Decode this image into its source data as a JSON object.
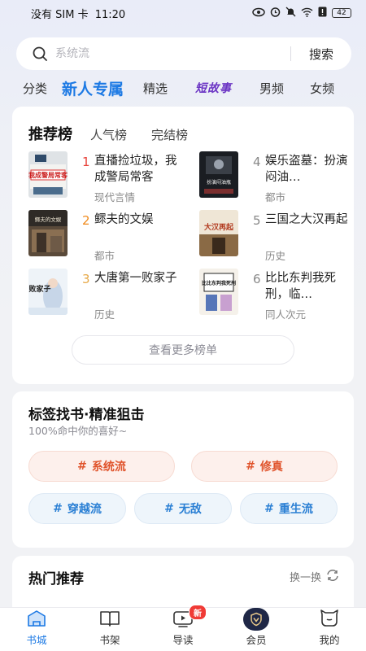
{
  "status_bar": {
    "carrier": "没有 SIM 卡",
    "time": "11:20",
    "battery": "42"
  },
  "search": {
    "placeholder": "系统流",
    "button": "搜索"
  },
  "channels": [
    "分类",
    "新人专属",
    "精选",
    "短故事",
    "男频",
    "女频"
  ],
  "active_channel": "新人专属",
  "ranking": {
    "tabs": [
      "推荐榜",
      "人气榜",
      "完结榜"
    ],
    "books": [
      {
        "rank": "1",
        "title": "直播捡垃圾，我成警局常客",
        "genre": "现代言情",
        "cover_text": "我成警局常客"
      },
      {
        "rank": "2",
        "title": "鳏夫的文娱",
        "genre": "都市",
        "cover_text": "鳏夫的文娱"
      },
      {
        "rank": "3",
        "title": "大唐第一败家子",
        "genre": "历史",
        "cover_text": "败家子"
      },
      {
        "rank": "4",
        "title": "娱乐盗墓：扮演闷油…",
        "genre": "都市",
        "cover_text": "扮演闷油瓶"
      },
      {
        "rank": "5",
        "title": "三国之大汉再起",
        "genre": "历史",
        "cover_text": "大汉再起"
      },
      {
        "rank": "6",
        "title": "比比东判我死刑，临…",
        "genre": "同人次元",
        "cover_text": "比比东判我死刑"
      }
    ],
    "more_button": "查看更多榜单"
  },
  "tags": {
    "title": "标签找书·精准狙击",
    "subtitle": "100%命中你的喜好~",
    "items": [
      {
        "label": "系统流",
        "style": "warm"
      },
      {
        "label": "修真",
        "style": "warm"
      },
      {
        "label": "穿越流",
        "style": "cool"
      },
      {
        "label": "无敌",
        "style": "cool"
      },
      {
        "label": "重生流",
        "style": "cool"
      }
    ],
    "hash": "#"
  },
  "hot": {
    "title": "热门推荐",
    "refresh": "换一换"
  },
  "bottom_nav": [
    {
      "label": "书城",
      "icon": "store-icon",
      "active": true
    },
    {
      "label": "书架",
      "icon": "bookshelf-icon"
    },
    {
      "label": "导读",
      "icon": "guide-video-icon",
      "badge": "新"
    },
    {
      "label": "会员",
      "icon": "vip-icon"
    },
    {
      "label": "我的",
      "icon": "profile-icon"
    }
  ],
  "colors": {
    "accent": "#1c79e4",
    "rank1": "#e8423a",
    "rank2": "#f08a1c",
    "rank3": "#e7a948",
    "tag_warm": "#e0542c",
    "tag_cool": "#2a7fd4"
  }
}
